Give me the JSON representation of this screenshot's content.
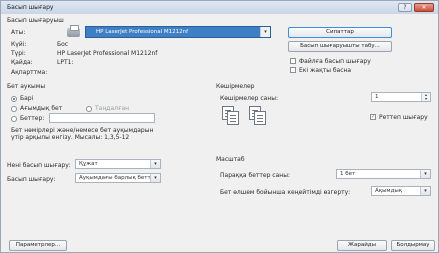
{
  "window": {
    "title": "Басып шығару",
    "btn_help": "?",
    "btn_close": "✕"
  },
  "printer_section": {
    "header": "Басып шығаруыш",
    "name_label": "Аты:",
    "name_value": "HP LaserJet Professional M1212nf",
    "status_label": "Күйі:",
    "status_value": "Бос",
    "type_label": "Түрі:",
    "type_value": "HP LaserJet Professional M1212nf",
    "where_label": "Қайда:",
    "where_value": "LPT1:",
    "comment_label": "Ақпарттма:",
    "properties_button": "Сипаттар",
    "find_button": "Басып шығаруышты табу...",
    "print_to_file_label": "Файлға басып шығару",
    "manual_duplex_label": "Екі жақты басна"
  },
  "page_range": {
    "header": "Бет аукымы",
    "all": "Барі",
    "current": "Ағымдық бет",
    "selection": "Таңдалған",
    "pages": "Беттер:",
    "hint": "Бет нөмірлері және/немесе бет ауқымдарын үтір арқылы енгізу. Мысалы: 1,3,5-12"
  },
  "copies": {
    "header": "Көшірмелер",
    "number_label": "Көшірмелер саны:",
    "number_value": "1",
    "collate_label": "Реттеп шығару"
  },
  "what": {
    "print_what_label": "Нені басып шығару:",
    "print_what_value": "Құжат",
    "print_label": "Басып шығару:",
    "print_value": "Ауқымдағы барлық беттер"
  },
  "zoom": {
    "header": "Масштаб",
    "pages_per_sheet_label": "Параққа беттер саны:",
    "pages_per_sheet_value": "1 бет",
    "scale_label": "Бет өлшем бойынша кеңейтімді өзгерту:",
    "scale_value": "Ақымдық"
  },
  "footer": {
    "options_button": "Параметрлер...",
    "ok_button": "Жарайды",
    "cancel_button": "Болдырмау"
  }
}
